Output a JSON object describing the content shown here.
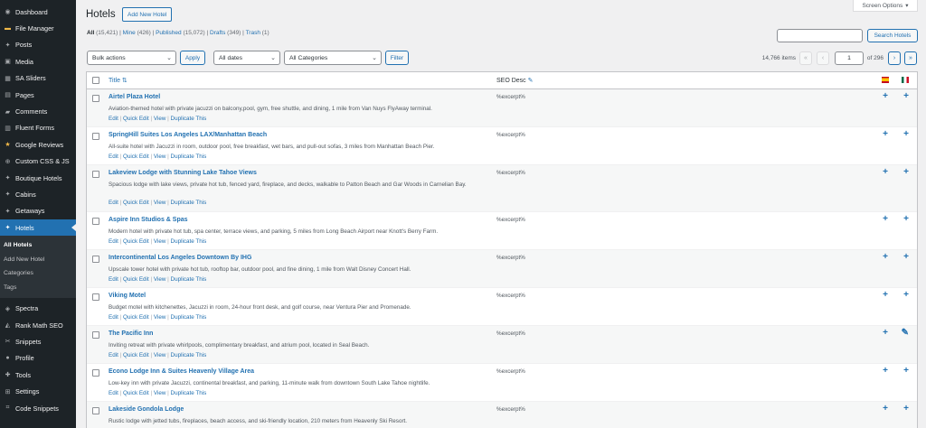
{
  "sidebar": {
    "items": [
      {
        "label": "Dashboard",
        "icon": "dashboard-icon"
      },
      {
        "label": "File Manager",
        "icon": "folder-icon"
      },
      {
        "label": "Posts",
        "icon": "pin-icon"
      },
      {
        "label": "Media",
        "icon": "media-icon"
      },
      {
        "label": "SA Sliders",
        "icon": "slider-icon"
      },
      {
        "label": "Pages",
        "icon": "pages-icon"
      },
      {
        "label": "Comments",
        "icon": "comment-icon"
      },
      {
        "label": "Fluent Forms",
        "icon": "forms-icon"
      },
      {
        "label": "Google Reviews",
        "icon": "star-icon"
      },
      {
        "label": "Custom CSS & JS",
        "icon": "plus-circle-icon"
      },
      {
        "label": "Boutique Hotels",
        "icon": "pin-icon"
      },
      {
        "label": "Cabins",
        "icon": "pin-icon"
      },
      {
        "label": "Getaways",
        "icon": "pin-icon"
      },
      {
        "label": "Hotels",
        "icon": "pin-icon"
      }
    ],
    "submenu": [
      "All Hotels",
      "Add New Hotel",
      "Categories",
      "Tags"
    ],
    "items_after": [
      {
        "label": "Spectra",
        "icon": "spectra-icon"
      },
      {
        "label": "Rank Math SEO",
        "icon": "rank-math-icon"
      },
      {
        "label": "Snippets",
        "icon": "scissors-icon"
      },
      {
        "label": "Profile",
        "icon": "user-icon"
      },
      {
        "label": "Tools",
        "icon": "wrench-icon"
      },
      {
        "label": "Settings",
        "icon": "settings-icon"
      },
      {
        "label": "Code Snippets",
        "icon": "code-icon"
      }
    ]
  },
  "header": {
    "screen_options": "Screen Options",
    "title": "Hotels",
    "add_new": "Add New Hotel"
  },
  "filters": {
    "all": "All",
    "all_count": "(15,421)",
    "mine": "Mine",
    "mine_count": "(426)",
    "published": "Published",
    "published_count": "(15,072)",
    "drafts": "Drafts",
    "drafts_count": "(349)",
    "trash": "Trash",
    "trash_count": "(1)",
    "sep": "|"
  },
  "search": {
    "button": "Search Hotels",
    "value": ""
  },
  "toolbar": {
    "bulk_actions": "Bulk actions",
    "apply": "Apply",
    "dates": "All dates",
    "categories": "All Categories",
    "filter": "Filter",
    "items": "14,766 items",
    "first": "«",
    "prev": "‹",
    "page": "1",
    "of": "of 296",
    "next": "›",
    "last": "»"
  },
  "table": {
    "col_title": "Title",
    "col_seo": "SEO Desc",
    "actions": {
      "edit": "Edit",
      "quick_edit": "Quick Edit",
      "view": "View",
      "duplicate": "Duplicate This",
      "sep": "|"
    },
    "rows": [
      {
        "title": "Airtel Plaza Hotel",
        "excerpt": "Aviation-themed hotel with private jacuzzi on balcony,pool, gym, free shuttle, and dining, 1 mile from Van Nuys FlyAway terminal.",
        "seo": "%excerpt%",
        "es": "+",
        "mx": "+"
      },
      {
        "title": "SpringHill Suites Los Angeles LAX/Manhattan Beach",
        "excerpt": "All-suite hotel with Jacuzzi in room, outdoor pool, free breakfast, wet bars, and pull-out sofas, 3 miles from Manhattan Beach Pier.",
        "seo": "%excerpt%",
        "es": "+",
        "mx": "+"
      },
      {
        "title": "Lakeview Lodge with Stunning Lake Tahoe Views",
        "excerpt": "Spacious lodge with lake views, private hot tub, fenced yard, fireplace, and decks, walkable to Patton Beach and Gar Woods in Carnelian Bay.",
        "seo": "%excerpt%",
        "es": "+",
        "mx": "+"
      },
      {
        "title": "Aspire Inn Studios & Spas",
        "excerpt": "Modern hotel with private hot tub, spa center, terrace views, and parking, 5 miles from Long Beach Airport near Knott's Berry Farm.",
        "seo": "%excerpt%",
        "es": "+",
        "mx": "+"
      },
      {
        "title": "Intercontinental Los Angeles Downtown By IHG",
        "excerpt": "Upscale tower hotel with private hot tub, rooftop bar, outdoor pool, and fine dining, 1 mile from Walt Disney Concert Hall.",
        "seo": "%excerpt%",
        "es": "+",
        "mx": "+"
      },
      {
        "title": "Viking Motel",
        "excerpt": "Budget motel with kitchenettes, Jacuzzi in room, 24-hour front desk, and golf course, near Ventura Pier and Promenade.",
        "seo": "%excerpt%",
        "es": "+",
        "mx": "+"
      },
      {
        "title": "The Pacific Inn",
        "excerpt": "Inviting retreat with private whirlpools, complimentary breakfast, and atrium pool, located in Seal Beach.",
        "seo": "%excerpt%",
        "es": "+",
        "mx": "✎"
      },
      {
        "title": "Econo Lodge Inn & Suites Heavenly Village Area",
        "excerpt": "Low-key inn with private Jacuzzi, continental breakfast, and parking, 11-minute walk from downtown South Lake Tahoe nightlife.",
        "seo": "%excerpt%",
        "es": "+",
        "mx": "+"
      },
      {
        "title": "Lakeside Gondola Lodge",
        "excerpt": "Rustic lodge with jetted tubs, fireplaces, beach access, and ski-friendly location, 210 meters from Heavenly Ski Resort.",
        "seo": "%excerpt%",
        "es": "+",
        "mx": "+"
      }
    ]
  }
}
